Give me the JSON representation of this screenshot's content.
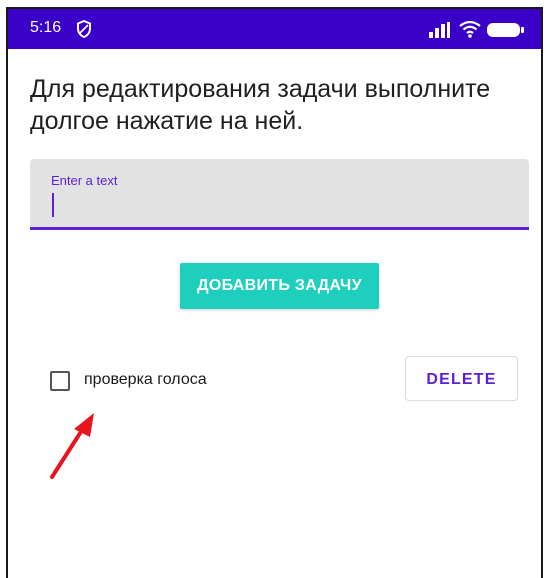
{
  "status_bar": {
    "time": "5:16",
    "background_color": "#3b00c8",
    "icons": [
      "shield-icon",
      "signal-icon",
      "wifi-icon",
      "battery-icon"
    ]
  },
  "instruction": "Для редактирования задачи выполните долгое нажатие на ней.",
  "input": {
    "hint": "Enter a text",
    "value": "",
    "accent_color": "#5b1fd6"
  },
  "add_button": {
    "label": "ДОБАВИТЬ ЗАДАЧУ",
    "color": "#1fcfbd"
  },
  "tasks": [
    {
      "label": "проверка голоса",
      "checked": false,
      "delete_label": "DELETE"
    }
  ],
  "annotation": {
    "arrow_color": "#e8141e",
    "icon": "red-arrow-icon"
  }
}
